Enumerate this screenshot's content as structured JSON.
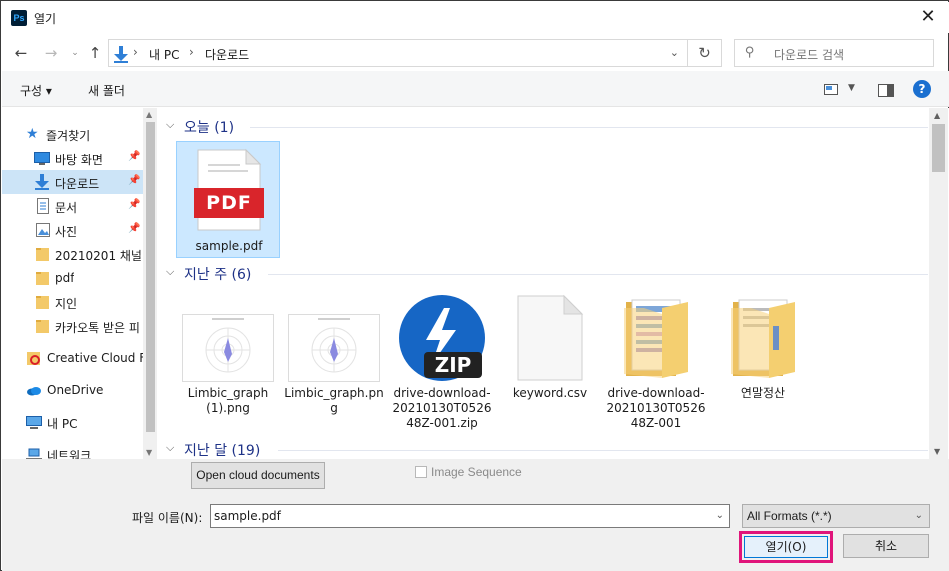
{
  "window": {
    "title": "열기",
    "app_icon": "Ps"
  },
  "nav": {
    "breadcrumb": [
      "내 PC",
      "다운로드"
    ],
    "search_placeholder": "다운로드 검색"
  },
  "toolbar": {
    "organize": "구성 ▾",
    "new_folder": "새 폴더"
  },
  "sidebar": {
    "items": [
      {
        "label": "즐겨찾기",
        "icon": "star-icon"
      },
      {
        "label": "바탕 화면",
        "icon": "desktop-icon",
        "pinned": true
      },
      {
        "label": "다운로드",
        "icon": "download-icon",
        "pinned": true,
        "selected": true
      },
      {
        "label": "문서",
        "icon": "document-icon",
        "pinned": true
      },
      {
        "label": "사진",
        "icon": "picture-icon",
        "pinned": true
      },
      {
        "label": "20210201 채널",
        "icon": "folder-icon"
      },
      {
        "label": "pdf",
        "icon": "folder-icon"
      },
      {
        "label": "지인",
        "icon": "folder-icon"
      },
      {
        "label": "카카오톡 받은 피",
        "icon": "folder-icon"
      },
      {
        "label": "Creative Cloud Fil",
        "icon": "creative-cloud-icon"
      },
      {
        "label": "OneDrive",
        "icon": "onedrive-icon"
      },
      {
        "label": "내 PC",
        "icon": "pc-icon"
      },
      {
        "label": "네트워크",
        "icon": "network-icon"
      }
    ]
  },
  "groups": [
    {
      "title": "오늘 (1)"
    },
    {
      "title": "지난 주 (6)"
    },
    {
      "title": "지난 달 (19)"
    }
  ],
  "files": [
    {
      "name_lines": [
        "sample.pdf"
      ],
      "type": "pdf",
      "pdf_text": "PDF"
    },
    {
      "name_lines": [
        "Limbic_graph",
        "(1).png"
      ],
      "type": "chart-thumb"
    },
    {
      "name_lines": [
        "Limbic_graph.pn",
        "g"
      ],
      "type": "chart-thumb"
    },
    {
      "name_lines": [
        "drive-download-",
        "20210130T0526",
        "48Z-001.zip"
      ],
      "type": "zip",
      "zip_text": "ZIP"
    },
    {
      "name_lines": [
        "keyword.csv"
      ],
      "type": "blank"
    },
    {
      "name_lines": [
        "drive-download-",
        "20210130T0526",
        "48Z-001"
      ],
      "type": "folder-docs"
    },
    {
      "name_lines": [
        "연말정산"
      ],
      "type": "folder-docs"
    }
  ],
  "bottom": {
    "open_cloud": "Open cloud documents",
    "image_sequence": "Image Sequence",
    "filename_label": "파일 이름(N):",
    "filename_value": "sample.pdf",
    "filter_value": "All Formats (*.*)",
    "open_button": "열기(O)",
    "cancel_button": "취소"
  },
  "colors": {
    "accent": "#0078d7",
    "highlight": "#e0157a",
    "pdf_red": "#d9252b",
    "selection": "#cce8ff",
    "group_title": "#1e3287"
  }
}
